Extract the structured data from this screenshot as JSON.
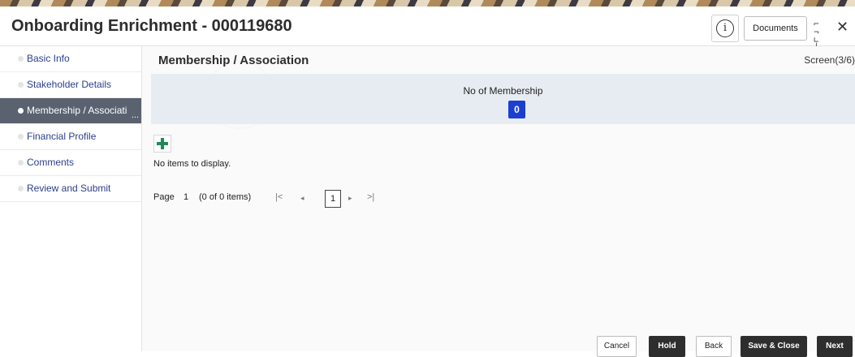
{
  "header": {
    "title": "Onboarding Enrichment - 000119680",
    "info_icon": "i",
    "documents_label": "Documents",
    "close_icon": "✕"
  },
  "sidebar": {
    "items": [
      {
        "label": "Basic Info"
      },
      {
        "label": "Stakeholder Details"
      },
      {
        "label": "Membership / Associati"
      },
      {
        "label": "Financial Profile"
      },
      {
        "label": "Comments"
      },
      {
        "label": "Review and Submit"
      }
    ],
    "active_index": 2,
    "more_indicator": "..."
  },
  "main": {
    "section_title": "Membership / Association",
    "screen_indicator": "Screen(3/6)",
    "membership_label": "No of Membership",
    "membership_count": "0",
    "empty_message": "No items to display.",
    "pager": {
      "page_label": "Page",
      "page_number": "1",
      "items_info": "(0 of 0 items)",
      "first_icon": "|<",
      "prev_icon": "◂",
      "current_page": "1",
      "next_icon": "▸",
      "last_icon": ">|"
    }
  },
  "footer": {
    "cancel": "Cancel",
    "hold": "Hold",
    "back": "Back",
    "save_close": "Save & Close",
    "next": "Next"
  },
  "colors": {
    "accent_blue": "#1b3fd1",
    "add_green": "#1e8a58",
    "active_sidebar": "#5a6270",
    "dark_button": "#2e2e2e"
  }
}
